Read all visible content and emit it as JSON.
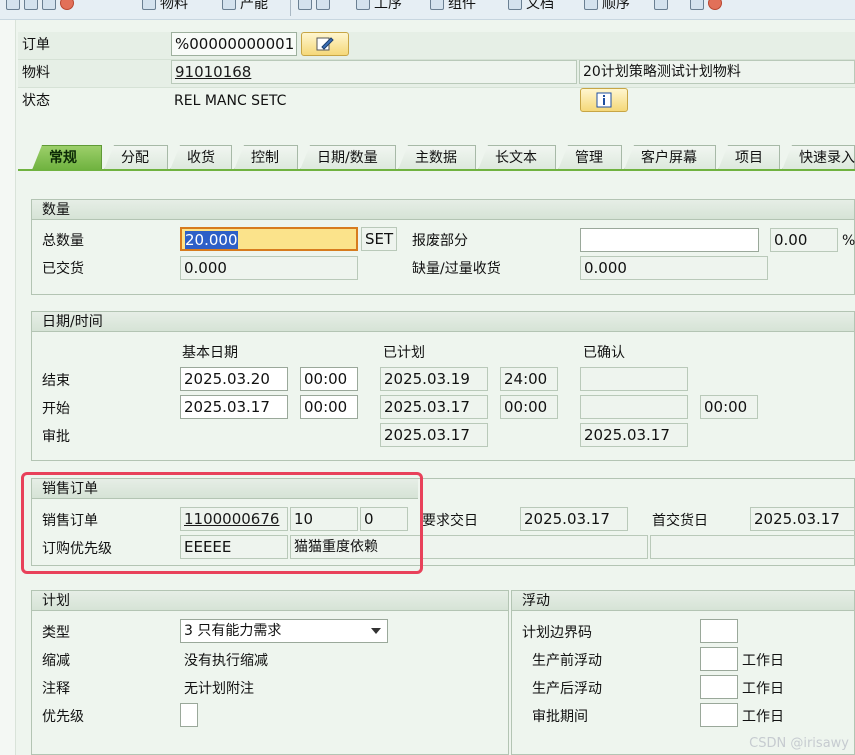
{
  "toolbar": {
    "items": [
      "物料",
      "产能",
      "工序",
      "组件",
      "文档",
      "顺序"
    ]
  },
  "header": {
    "order_label": "订单",
    "order_value": "%00000000001",
    "material_label": "物料",
    "material_value": "91010168",
    "material_desc": "20计划策略测试计划物料",
    "status_label": "状态",
    "status_value": "REL  MANC SETC"
  },
  "tabs": [
    "常规",
    "分配",
    "收货",
    "控制",
    "日期/数量",
    "主数据",
    "长文本",
    "管理",
    "客户屏幕",
    "项目",
    "快速录入"
  ],
  "quantity": {
    "title": "数量",
    "total_label": "总数量",
    "total_value": "20.000",
    "unit": "SET",
    "scrap_label": "报废部分",
    "scrap_value": "",
    "scrap_pct": "0.00",
    "pct_sign": "%",
    "delivered_label": "已交货",
    "delivered_value": "0.000",
    "shortfall_label": "缺量/过量收货",
    "shortfall_value": "0.000"
  },
  "dates": {
    "title": "日期/时间",
    "col_basic": "基本日期",
    "col_scheduled": "已计划",
    "col_confirmed": "已确认",
    "end_label": "结束",
    "start_label": "开始",
    "release_label": "审批",
    "end_basic_date": "2025.03.20",
    "end_basic_time": "00:00",
    "end_sched_date": "2025.03.19",
    "end_sched_time": "24:00",
    "start_basic_date": "2025.03.17",
    "start_basic_time": "00:00",
    "start_sched_date": "2025.03.17",
    "start_sched_time": "00:00",
    "start_conf_time": "00:00",
    "release_sched_date": "2025.03.17",
    "release_conf_date": "2025.03.17"
  },
  "sales": {
    "title": "销售订单",
    "so_label": "销售订单",
    "so_number": "1100000676",
    "so_item": "10",
    "so_schedule": "0",
    "req_delivery_label": "要求交日",
    "req_delivery_value": "2025.03.17",
    "first_delivery_label": "首交货日",
    "first_delivery_value": "2025.03.17",
    "priority_label": "订购优先级",
    "priority_value": "EEEEE",
    "priority_text": "猫猫重度依赖"
  },
  "plan": {
    "title": "计划",
    "type_label": "类型",
    "type_value": "3 只有能力需求",
    "reduction_label": "缩减",
    "reduction_value": "没有执行缩减",
    "note_label": "注释",
    "note_value": "无计划附注",
    "priority_label": "优先级",
    "priority_value": ""
  },
  "float": {
    "title": "浮动",
    "margin_label": "计划边界码",
    "pre_label": "生产前浮动",
    "post_label": "生产后浮动",
    "release_label": "审批期间",
    "unit": "工作日"
  },
  "watermark": "CSDN @irisawy"
}
